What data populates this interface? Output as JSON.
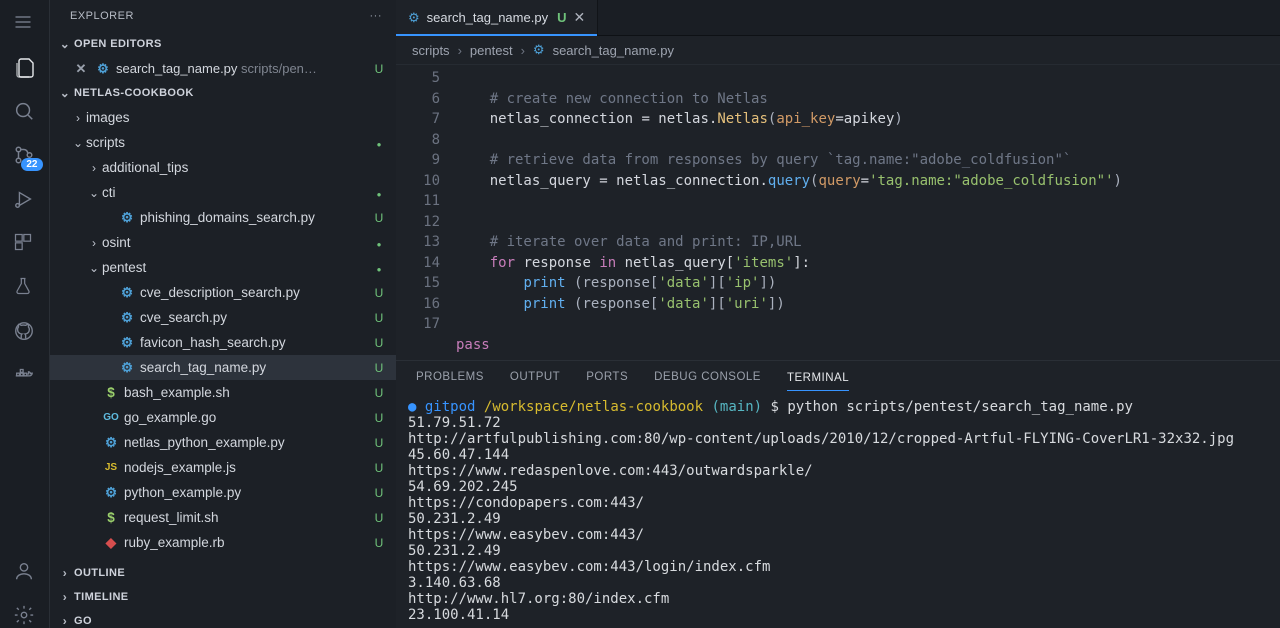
{
  "explorer": {
    "title": "EXPLORER"
  },
  "sections": {
    "open_editors": "OPEN EDITORS",
    "project": "NETLAS-COOKBOOK",
    "outline": "OUTLINE",
    "timeline": "TIMELINE",
    "go": "GO"
  },
  "open_editor_entry": {
    "name": "search_tag_name.py",
    "hint": "scripts/pen…",
    "status": "U"
  },
  "tree": {
    "images": "images",
    "scripts": "scripts",
    "additional_tips": "additional_tips",
    "cti": "cti",
    "phishing": "phishing_domains_search.py",
    "osint": "osint",
    "pentest": "pentest",
    "cve_desc": "cve_description_search.py",
    "cve_search": "cve_search.py",
    "favicon": "favicon_hash_search.py",
    "search_tag": "search_tag_name.py",
    "bash": "bash_example.sh",
    "go": "go_example.go",
    "netlas_py": "netlas_python_example.py",
    "nodejs": "nodejs_example.js",
    "python_ex": "python_example.py",
    "request_limit": "request_limit.sh",
    "ruby": "ruby_example.rb"
  },
  "scm_badge": "22",
  "tab": {
    "name": "search_tag_name.py",
    "status": "U"
  },
  "breadcrumbs": {
    "a": "scripts",
    "b": "pentest",
    "c": "search_tag_name.py"
  },
  "code_lines": {
    "l5": "    # create new connection to Netlas",
    "l6a": "    netlas_connection ",
    "l6b": "=",
    "l6c": " netlas",
    "l6d": ".",
    "l6e": "Netlas",
    "l6f": "(",
    "l6g": "api_key",
    "l6h": "=",
    "l6i": "apikey",
    "l6j": ")",
    "l8": "    # retrieve data from responses by query `tag.name:\"adobe_coldfusion\"`",
    "l9a": "    netlas_query ",
    "l9b": "=",
    "l9c": " netlas_connection",
    "l9d": ".",
    "l9e": "query",
    "l9f": "(",
    "l9g": "query",
    "l9h": "=",
    "l9i": "'tag.name:\"adobe_coldfusion\"'",
    "l9j": ")",
    "l12": "    # iterate over data and print: IP,URL",
    "l13a": "    ",
    "l13b": "for",
    "l13c": " response ",
    "l13d": "in",
    "l13e": " netlas_query[",
    "l13f": "'items'",
    "l13g": "]:",
    "l14a": "        ",
    "l14b": "print",
    "l14c": " (response[",
    "l14d": "'data'",
    "l14e": "][",
    "l14f": "'ip'",
    "l14g": "])",
    "l15a": "        ",
    "l15b": "print",
    "l15c": " (response[",
    "l15d": "'data'",
    "l15e": "][",
    "l15f": "'uri'",
    "l15g": "])",
    "l17": "pass"
  },
  "gutter": [
    "5",
    "6",
    "7",
    "8",
    "9",
    "10",
    "11",
    "12",
    "13",
    "14",
    "15",
    "16",
    "17"
  ],
  "panel_tabs": {
    "problems": "PROBLEMS",
    "output": "OUTPUT",
    "ports": "PORTS",
    "debug": "DEBUG CONSOLE",
    "terminal": "TERMINAL"
  },
  "terminal": {
    "prompt_marker": "●",
    "prompt_user": "gitpod",
    "prompt_path": "/workspace/netlas-cookbook",
    "prompt_branch": "(main)",
    "prompt_sym": "$",
    "cmd": "python scripts/pentest/search_tag_name.py",
    "lines": [
      "51.79.51.72",
      "http://artfulpublishing.com:80/wp-content/uploads/2010/12/cropped-Artful-FLYING-CoverLR1-32x32.jpg",
      "45.60.47.144",
      "https://www.redaspenlove.com:443/outwardsparkle/",
      "54.69.202.245",
      "https://condopapers.com:443/",
      "50.231.2.49",
      "https://www.easybev.com:443/",
      "50.231.2.49",
      "https://www.easybev.com:443/login/index.cfm",
      "3.140.63.68",
      "http://www.hl7.org:80/index.cfm",
      "23.100.41.14"
    ]
  }
}
